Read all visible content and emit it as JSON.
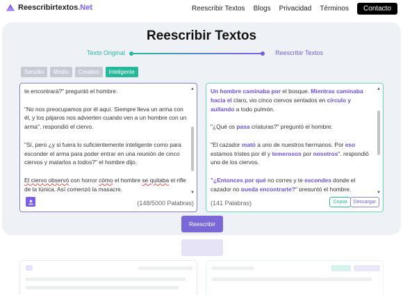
{
  "brand": {
    "name": "Reescribirtextos",
    "suffix": ".Net"
  },
  "nav": {
    "links": [
      "Reescribir Textos",
      "Blogs",
      "Privacidad",
      "Términos"
    ],
    "cta": "Contacto"
  },
  "page": {
    "title": "Reescribir Textos"
  },
  "flow": {
    "source": "Texto Original",
    "target": "Reescribir Textos"
  },
  "modes": [
    {
      "label": "Sencillo",
      "active": false
    },
    {
      "label": "Medio",
      "active": false
    },
    {
      "label": "Creativo",
      "active": false
    },
    {
      "label": "Inteligente",
      "active": true
    }
  ],
  "input_panel": {
    "line1": "te encontrará?\" preguntó el hombre.",
    "para2": "\"No nos preocupamos por él aquí. Siempre lleva un arma con él, y los pájaros nos advierten cuando ven a un hombre con un arma\". respondió el ciervo.",
    "para3": "\"Sí, pero ¿y si fuera lo suficientemente inteligente como para esconder el arma para poder entrar en una reunión de cinco ciervos y matarlos a todos?\" el hombre dijo.",
    "para4": {
      "t1": "El ciervo observó",
      "t2": " con horror ",
      "t3": "cómo",
      "t4": " el hombre ",
      "t5": "se quitaba",
      "t6": " el rifle ",
      "t7": "de la túnica",
      "t8": ". ",
      "t9": "Así comenzó",
      "t10": " la ",
      "t11": "masacre",
      "t12": "."
    },
    "word_count": "(148/5000 Palabras)",
    "scroll_fraction": 0.65
  },
  "output_panel": {
    "p1": {
      "a": "Un hombre caminaba por",
      "b": " el bosque. ",
      "c": "Mientras caminaba hacia el",
      "d": " claro, vio cinco ciervos sentados en ",
      "e": "círculo y aullando",
      "f": " a todo pulmón."
    },
    "p2": {
      "a": "\"¿Qué os ",
      "b": "pasa",
      "c": " criaturas?\" preguntó el hombre."
    },
    "p3": {
      "a": "\"El cazador ",
      "b": "mató",
      "c": " a uno de nuestros hermanos. Por ",
      "d": "eso",
      "e": " estamos tristes por él y ",
      "f": "temerosos",
      "g": " por ",
      "h": "nosotros",
      "i": "\". respondió uno de los ciervos."
    },
    "p4": {
      "a": "\"¿Entonces por qué",
      "b": " no corres y te ",
      "c": "escondes",
      "d": " donde el cazador no ",
      "e": "pueda encontrarte?",
      "f": "\" preguntó el hombre."
    },
    "word_count": "(141 Palabras)",
    "copy_label": "Copiar",
    "download_label": "Descargar",
    "scroll_fraction": 0.35
  },
  "submit_label": "Reescribir",
  "colors": {
    "accent": "#7b5cf0",
    "teal": "#26b89a",
    "cta_bg": "#000000"
  }
}
